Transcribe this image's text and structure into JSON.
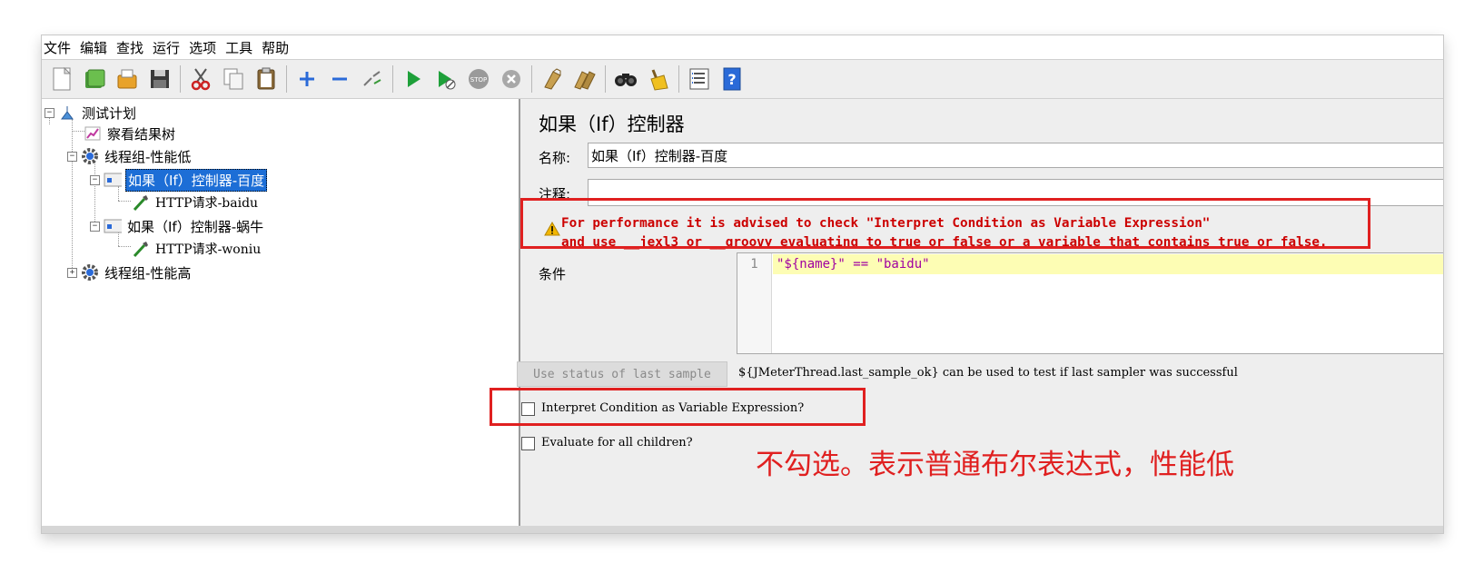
{
  "menu": [
    "文件",
    "编辑",
    "查找",
    "运行",
    "选项",
    "工具",
    "帮助"
  ],
  "toolbar_icons": [
    "new-icon",
    "templates-icon",
    "open-icon",
    "save-icon",
    "cut-icon",
    "copy-icon",
    "paste-icon",
    "expand-icon",
    "collapse-icon",
    "toggle-icon",
    "start-icon",
    "start-no-pause-icon",
    "stop-icon",
    "shutdown-icon",
    "clear-icon",
    "clear-all-icon",
    "search-icon",
    "reset-search-icon",
    "function-helper-icon",
    "help-icon"
  ],
  "tree": {
    "test_plan": "测试计划",
    "view_results_tree": "察看结果树",
    "thread_group_low": "线程组-性能低",
    "if_baidu": "如果（If）控制器-百度",
    "http_baidu": "HTTP请求-baidu",
    "if_woniu": "如果（If）控制器-蜗牛",
    "http_woniu": "HTTP请求-woniu",
    "thread_group_high": "线程组-性能高"
  },
  "panel": {
    "title": "如果（If）控制器",
    "name_label": "名称:",
    "name_value": "如果（If）控制器-百度",
    "comment_label": "注释:",
    "comment_value": "",
    "warning_line1": "For performance it is advised to check \"Interpret Condition as Variable Expression\"",
    "warning_line2": "and use __jexl3 or __groovy evaluating to true or false or a variable that contains true or false.",
    "condition_label": "条件",
    "condition_line_no": "1",
    "condition_code": "\"${name}\" == \"baidu\"",
    "use_status_button": "Use status of last sample",
    "status_hint": "${JMeterThread.last_sample_ok} can be used to test if last sampler was successful",
    "interpret_checkbox": "Interpret Condition as Variable Expression?",
    "interpret_checked": false,
    "evaluate_checkbox": "Evaluate for all children?",
    "evaluate_checked": false,
    "annotation": "不勾选。表示普通布尔表达式，性能低"
  },
  "colors": {
    "selection": "#1d6ed6",
    "warning": "#cc0000",
    "annotation": "#e02020",
    "code_highlight": "#fdfdb4"
  }
}
